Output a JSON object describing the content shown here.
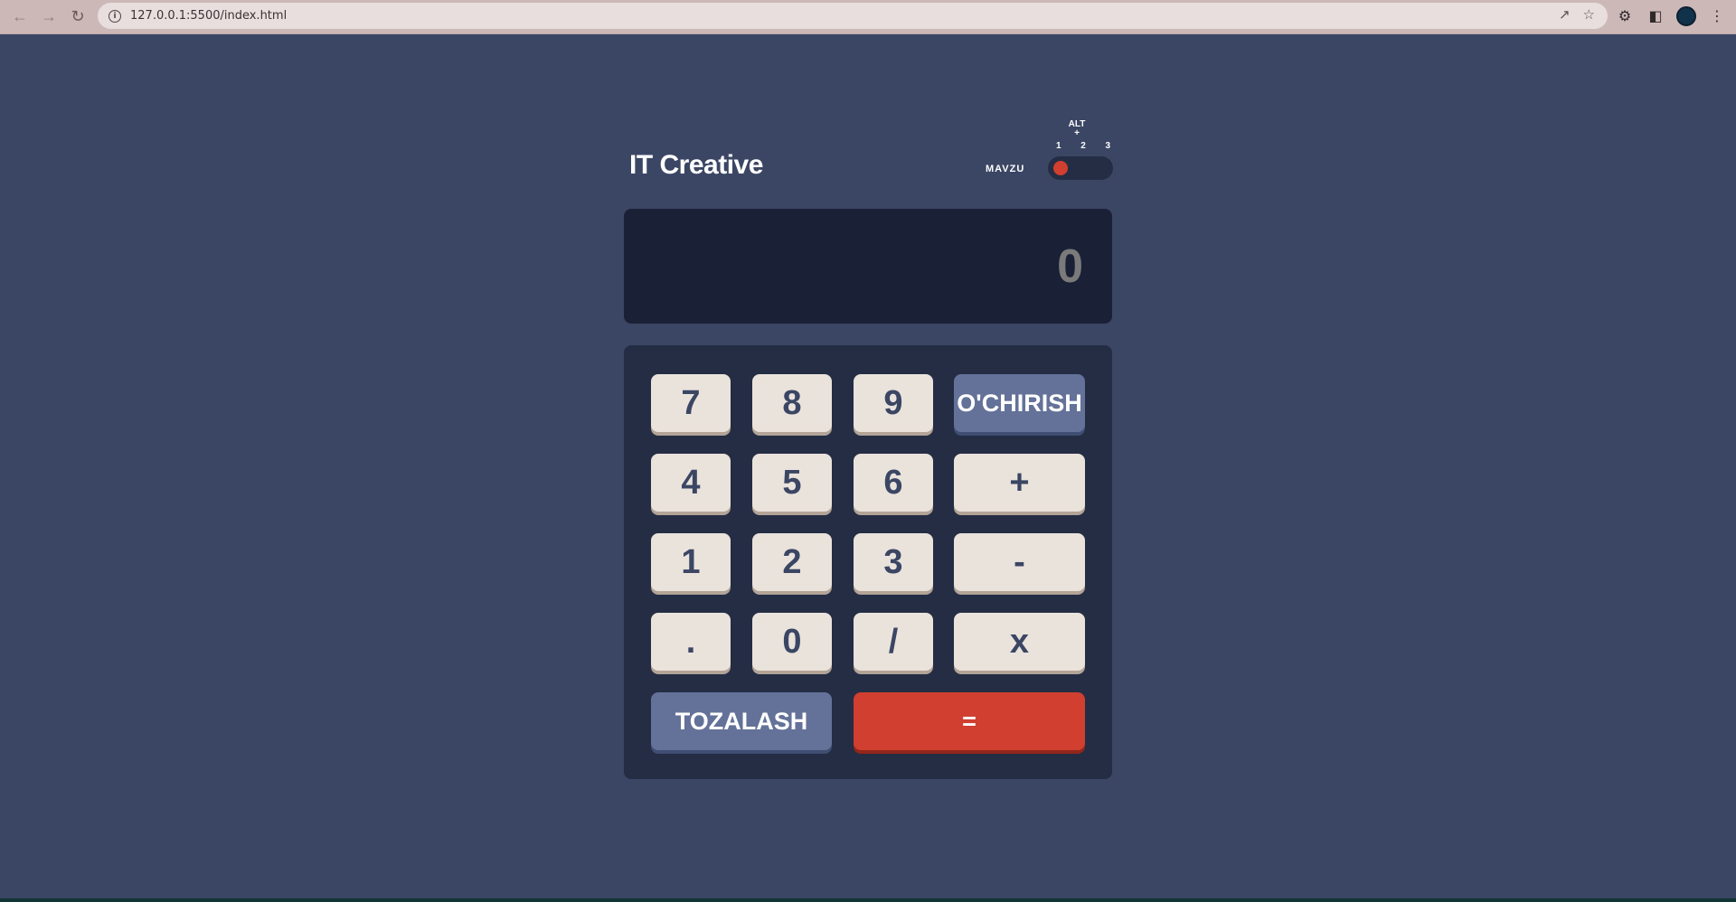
{
  "browser": {
    "url": "127.0.0.1:5500/index.html",
    "icons": [
      "back-arrow-icon",
      "forward-arrow-icon",
      "reload-icon",
      "info-icon",
      "share-icon",
      "star-icon",
      "extensions-icon",
      "sidepanel-icon",
      "profile-avatar-icon",
      "menu-dots-icon"
    ]
  },
  "app": {
    "title": "IT Creative",
    "theme": {
      "label": "MAVZU",
      "hint": "ALT\n+",
      "options": [
        "1",
        "2",
        "3"
      ],
      "selected": 1
    },
    "display": {
      "value": "0"
    },
    "keys": {
      "k7": "7",
      "k8": "8",
      "k9": "9",
      "del": "O'CHIRISH",
      "k4": "4",
      "k5": "5",
      "k6": "6",
      "add": "+",
      "k1": "1",
      "k2": "2",
      "k3": "3",
      "sub": "-",
      "dot": ".",
      "k0": "0",
      "div": "/",
      "mul": "x",
      "reset": "TOZALASH",
      "equals": "="
    },
    "colors": {
      "background": "#3b4664",
      "screen": "#1a2036",
      "keypad": "#242d44",
      "key": "#eae3dc",
      "key_text": "#3b4664",
      "accent_blue": "#647299",
      "accent_red": "#d03f2f"
    }
  }
}
